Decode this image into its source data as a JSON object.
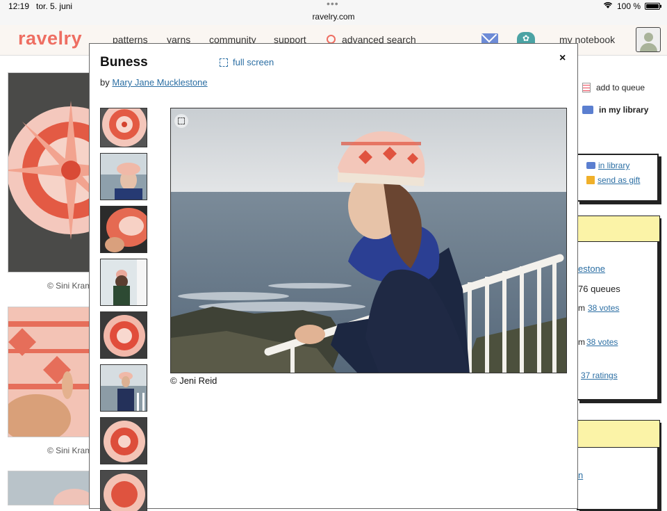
{
  "status_bar": {
    "time": "12:19",
    "date": "tor. 5. juni",
    "url": "ravelry.com",
    "battery": "100 %"
  },
  "nav": {
    "logo": "ravelry",
    "patterns": "patterns",
    "yarns": "yarns",
    "community": "community",
    "support": "support",
    "advanced_search": "advanced search",
    "my_notebook": "my notebook"
  },
  "background": {
    "credit1": "© Sini Kram",
    "credit2": "© Sini Kram",
    "add_to_queue": "add to queue",
    "in_my_library": "in my library",
    "in_library": "in library",
    "send_as_gift": "send as gift",
    "designer_partial": "estone",
    "queues": "76 queues",
    "votes1": "38 votes",
    "votes2": "38 votes",
    "ratings": "37 ratings",
    "m1": "m",
    "m2": "m",
    "n_partial": "n"
  },
  "modal": {
    "title": "Buness",
    "full_screen": "full screen",
    "close": "×",
    "by": "by",
    "author": "Mary Jane Mucklestone",
    "photo_credit": "© Jeni Reid"
  },
  "colors": {
    "accent": "#ee6e62",
    "link": "#2b6ea3",
    "yellow": "#fbf3a7"
  },
  "icons": [
    "search-icon",
    "envelope-icon",
    "forum-icon",
    "fullscreen-icon",
    "close-icon",
    "expand-icon",
    "queue-icon",
    "library-icon",
    "gift-icon"
  ]
}
